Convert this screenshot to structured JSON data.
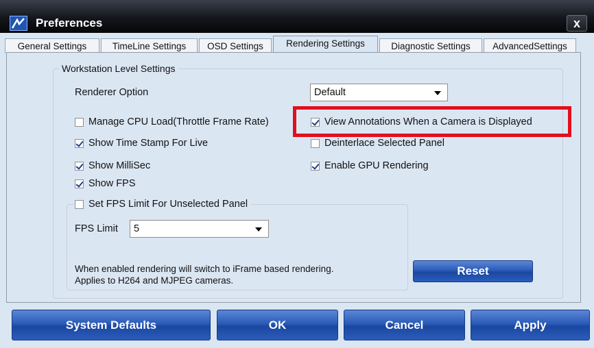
{
  "window": {
    "title": "Preferences",
    "close_label": "x"
  },
  "tabs": [
    {
      "label": "General Settings"
    },
    {
      "label": "TimeLine Settings"
    },
    {
      "label": "OSD Settings"
    },
    {
      "label": "Rendering Settings",
      "active": true
    },
    {
      "label": "Diagnostic Settings"
    },
    {
      "label": "AdvancedSettings"
    }
  ],
  "group": {
    "title": "Workstation Level Settings",
    "renderer_label": "Renderer Option",
    "renderer_value": "Default",
    "options": {
      "manage_cpu": {
        "label": "Manage CPU Load(Throttle Frame Rate)",
        "checked": false
      },
      "view_annotations": {
        "label": "View Annotations When a Camera is Displayed",
        "checked": true
      },
      "show_timestamp": {
        "label": "Show Time Stamp For Live",
        "checked": true
      },
      "deinterlace": {
        "label": "Deinterlace Selected Panel",
        "checked": false
      },
      "show_millisec": {
        "label": "Show MilliSec",
        "checked": true
      },
      "enable_gpu": {
        "label": "Enable GPU Rendering",
        "checked": true
      },
      "show_fps": {
        "label": "Show FPS",
        "checked": true
      },
      "set_fps_limit": {
        "label": "Set FPS Limit For Unselected Panel",
        "checked": false
      }
    },
    "fps_limit_label": "FPS Limit",
    "fps_limit_value": "5",
    "note_line1": "When enabled rendering will switch to iFrame based rendering.",
    "note_line2": "Applies to H264 and MJPEG cameras.",
    "reset_label": "Reset"
  },
  "footer": {
    "system_defaults": "System Defaults",
    "ok": "OK",
    "cancel": "Cancel",
    "apply": "Apply"
  },
  "colors": {
    "highlight": "#e10f1e",
    "button_blue": "#2b5cb8",
    "title_bar": "#14161c"
  }
}
